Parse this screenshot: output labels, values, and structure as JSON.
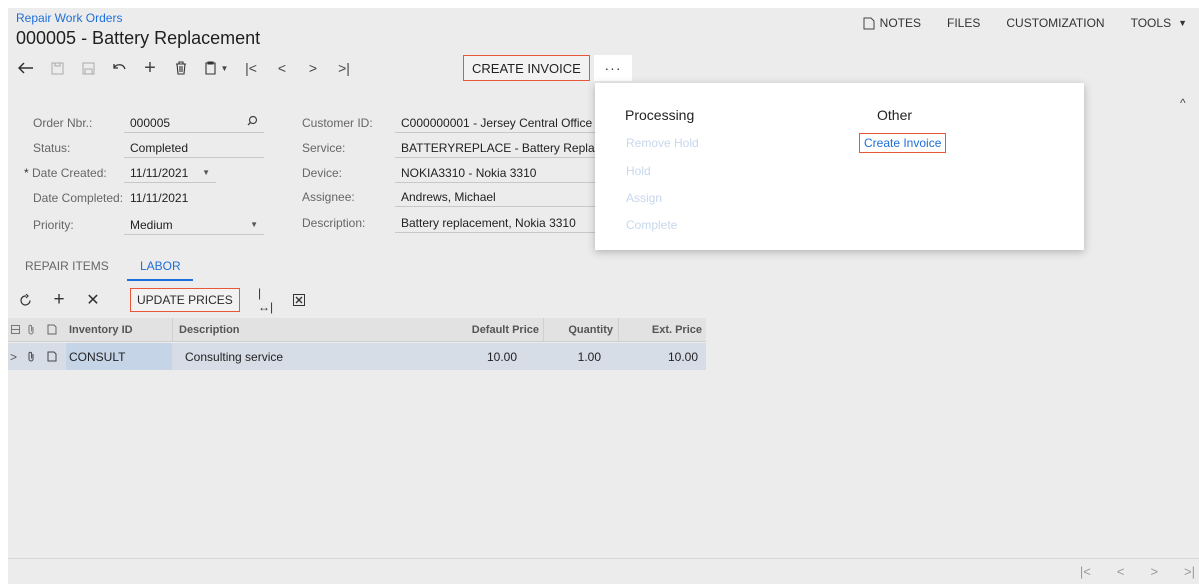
{
  "breadcrumb": "Repair Work Orders",
  "title": "000005 - Battery Replacement",
  "toplinks": {
    "notes": "NOTES",
    "files": "FILES",
    "customization": "CUSTOMIZATION",
    "tools": "TOOLS"
  },
  "toolbar": {
    "create_invoice": "CREATE INVOICE",
    "more": "···"
  },
  "form": {
    "order_nbr": {
      "label": "Order Nbr.:",
      "value": "000005"
    },
    "status": {
      "label": "Status:",
      "value": "Completed"
    },
    "date_created": {
      "label": "Date Created:",
      "value": "11/11/2021"
    },
    "date_completed": {
      "label": "Date Completed:",
      "value": "11/11/2021"
    },
    "priority": {
      "label": "Priority:",
      "value": "Medium"
    },
    "customer_id": {
      "label": "Customer ID:",
      "value": "C000000001 - Jersey Central Office"
    },
    "service": {
      "label": "Service:",
      "value": "BATTERYREPLACE - Battery Replac"
    },
    "device": {
      "label": "Device:",
      "value": "NOKIA3310 - Nokia 3310"
    },
    "assignee": {
      "label": "Assignee:",
      "value": "Andrews, Michael"
    },
    "description": {
      "label": "Description:",
      "value": "Battery replacement, Nokia 3310"
    }
  },
  "tabs": {
    "repair_items": "REPAIR ITEMS",
    "labor": "LABOR"
  },
  "grid_toolbar": {
    "update_prices": "UPDATE PRICES"
  },
  "grid": {
    "headers": {
      "inventory_id": "Inventory ID",
      "description": "Description",
      "default_price": "Default Price",
      "quantity": "Quantity",
      "ext_price": "Ext. Price"
    },
    "rows": [
      {
        "inventory_id": "CONSULT",
        "description": "Consulting service",
        "default_price": "10.00",
        "quantity": "1.00",
        "ext_price": "10.00"
      }
    ]
  },
  "menu": {
    "processing": {
      "header": "Processing",
      "items": [
        "Remove Hold",
        "Hold",
        "Assign",
        "Complete"
      ]
    },
    "other": {
      "header": "Other",
      "items": [
        "Create Invoice"
      ]
    }
  },
  "colors": {
    "accent": "#1e6fd9",
    "highlight_border": "#e8573a",
    "disabled_menu_item": "#c7d7ec"
  }
}
